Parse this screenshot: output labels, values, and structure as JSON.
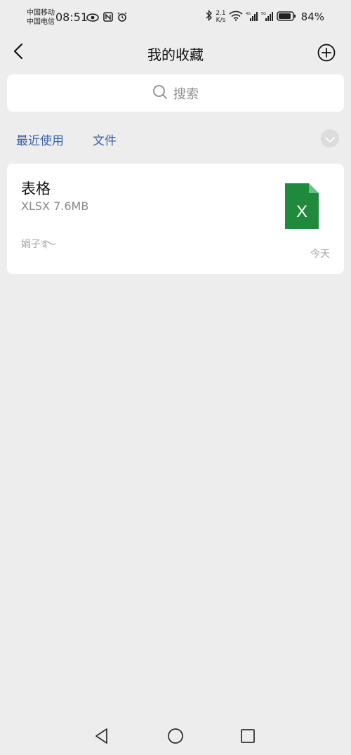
{
  "status_bar": {
    "carrier_1": "中国移动",
    "carrier_2": "中国电信",
    "time": "08:51",
    "net_speed_value": "2.1",
    "net_speed_unit": "K/s",
    "battery_percent": "84%",
    "icons": [
      "eye-icon",
      "nfc-icon",
      "alarm-icon",
      "bluetooth-icon",
      "wifi-icon",
      "signal-icon",
      "signal-icon",
      "battery-icon"
    ]
  },
  "header": {
    "title": "我的收藏",
    "back_icon": "chevron-left-icon",
    "add_icon": "plus-circle-icon"
  },
  "search": {
    "placeholder": "搜索",
    "icon": "search-icon"
  },
  "filters": {
    "recent_label": "最近使用",
    "file_label": "文件",
    "expand_icon": "chevron-down-icon"
  },
  "items": [
    {
      "title": "表格",
      "meta": "XLSX 7.6MB",
      "source": "娟子࿐",
      "date": "今天",
      "icon": "excel-file-icon",
      "icon_color": "#1f8a3c"
    }
  ],
  "nav_bar": {
    "icons": [
      "back-triangle-icon",
      "home-circle-icon",
      "recents-square-icon"
    ]
  },
  "colors": {
    "background": "#ededed",
    "card": "#ffffff",
    "link": "#3a63a8",
    "excel_green": "#1f8a3c"
  }
}
